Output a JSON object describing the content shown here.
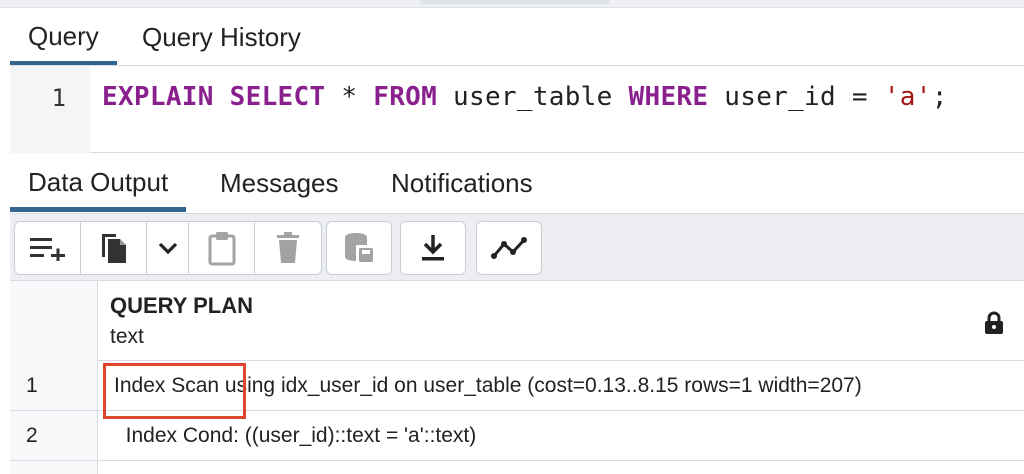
{
  "query_tabs": [
    {
      "label": "Query",
      "active": true
    },
    {
      "label": "Query History",
      "active": false
    }
  ],
  "editor": {
    "line_number": "1",
    "tokens": [
      {
        "text": "EXPLAIN",
        "kind": "keyword"
      },
      {
        "text": " ",
        "kind": "plain"
      },
      {
        "text": "SELECT",
        "kind": "keyword"
      },
      {
        "text": " * ",
        "kind": "plain"
      },
      {
        "text": "FROM",
        "kind": "keyword"
      },
      {
        "text": " user_table ",
        "kind": "plain"
      },
      {
        "text": "WHERE",
        "kind": "keyword"
      },
      {
        "text": " user_id = ",
        "kind": "plain"
      },
      {
        "text": "'a'",
        "kind": "string"
      },
      {
        "text": ";",
        "kind": "plain"
      }
    ]
  },
  "output_tabs": [
    {
      "label": "Data Output",
      "active": true
    },
    {
      "label": "Messages",
      "active": false
    },
    {
      "label": "Notifications",
      "active": false
    }
  ],
  "toolbar": {
    "icons": [
      "add-row-icon",
      "copy-icon",
      "chevron-down-icon",
      "paste-icon",
      "delete-icon",
      "save-data-icon",
      "download-icon",
      "graph-icon"
    ]
  },
  "grid": {
    "column": {
      "name": "QUERY PLAN",
      "type": "text",
      "lock_icon": "lock-icon"
    },
    "rows": [
      {
        "num": "1",
        "value": "Index Scan using idx_user_id on user_table  (cost=0.13..8.15 rows=1 width=207)"
      },
      {
        "num": "2",
        "value": "  Index Cond: ((user_id)::text = 'a'::text)"
      }
    ]
  },
  "colors": {
    "accent": "#326690",
    "keyword": "#8a1f8e",
    "string": "#a31515",
    "highlight_box": "#e0452d"
  }
}
